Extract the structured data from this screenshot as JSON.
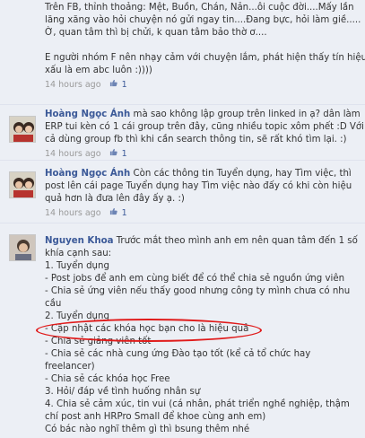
{
  "comments": [
    {
      "author": "",
      "lines": [
        "Trên FB, thỉnh thoảng: Mệt, Buồn, Chán, Nản...ôi cuộc đời....Mấy lần",
        "lăng xăng vào hỏi chuyện nó gửi ngay tin....Đang bực, hỏi làm giề.....",
        "Ờ, quan tâm thì bị chửi, k quan tâm bảo thờ ơ....",
        "",
        "E người nhóm F nên nhạy cảm với chuyện lắm, phát hiện thấy tín hiệu",
        "xấu là em abc luôn :))))"
      ],
      "time": "14 hours ago",
      "likes": "1"
    },
    {
      "author": "Hoàng Ngọc Ánh",
      "lines": [
        "mà sao không lập group trên linked in ạ? dân làm",
        "ERP tui kèn có 1 cái group trên đây, cũng nhiều topic xôm phết :D Với",
        "cả dùng group fb thì khi cần search thông tin, sẽ rất khó tìm lại. :)"
      ],
      "time": "14 hours ago",
      "likes": "1"
    },
    {
      "author": "Hoàng Ngọc Ánh",
      "lines": [
        "Còn các thông tin Tuyển dụng, hay Tìm việc, thì",
        "post lên cái page Tuyển dụng hay Tìm việc nào đấy có khi còn hiệu",
        "quả hơn là đưa lên đây ấy ạ. :)"
      ],
      "time": "14 hours ago",
      "likes": "1"
    },
    {
      "author": "Nguyen Khoa",
      "lines": [
        "Trước mắt theo mình anh em nên quan tâm đến 1 số",
        "khía cạnh sau:",
        "1. Tuyển dụng",
        "- Post jobs để anh em cùng biết để có thể chia sẻ nguồn ứng viên",
        "- Chia sẻ ứng viên nếu thấy good nhưng công ty mình chưa có nhu",
        "cầu",
        "2. Tuyển dụng",
        "- Cập nhật các khóa học bạn cho là hiệu quả",
        "- Chia sẻ giảng viên tốt",
        "- Chia sẻ các nhà cung ứng Đào tạo tốt (kể cả tổ chức hay",
        "freelancer)",
        "- Chia sẻ các khóa học Free",
        "3. Hỏi/ đáp về tình huống nhân sự",
        "4. Chia sẻ cảm xúc, tin vui (cá nhân, phát triển nghề nghiệp, thậm",
        "chí post anh HRPro Small để khoe cùng anh em)",
        "Có bác nào nghĩ thêm gì thì bsung thêm nhé"
      ],
      "time": "",
      "likes": ""
    }
  ],
  "colors": {
    "background": "#eceff5",
    "author": "#3b5998",
    "highlight_oval": "#e01a1a"
  },
  "icons": {
    "like": "thumbs-up-icon"
  }
}
